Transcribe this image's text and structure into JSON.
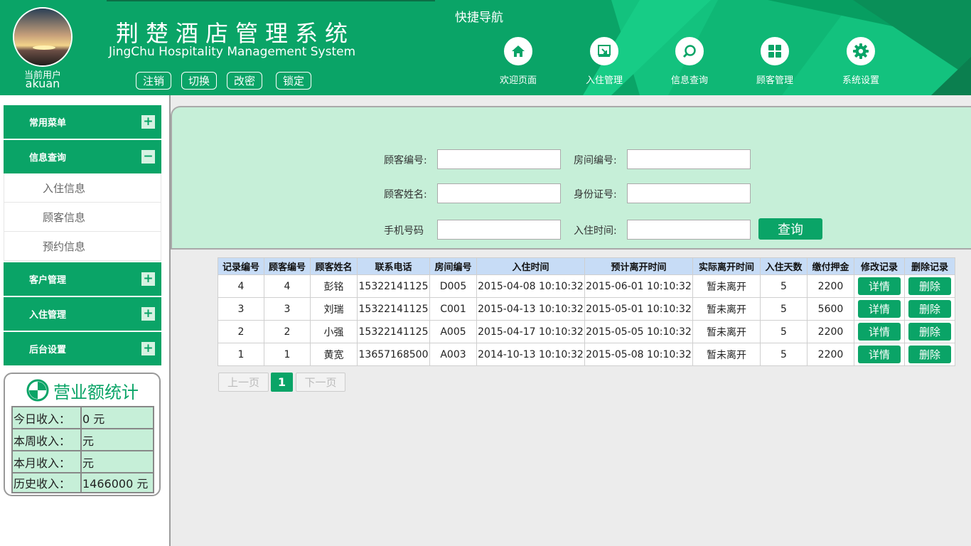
{
  "header": {
    "system_title": "荆楚酒店管理系统",
    "system_subtitle": "JingChu Hospitality Management System",
    "current_user_label": "当前用户",
    "current_user_name": "akuan",
    "user_actions": [
      "注销",
      "切换",
      "改密",
      "锁定"
    ],
    "quick_nav_title": "快捷导航",
    "quick_nav": [
      {
        "label": "欢迎页面",
        "icon": "home-icon"
      },
      {
        "label": "入住管理",
        "icon": "checkin-icon"
      },
      {
        "label": "信息查询",
        "icon": "search-icon"
      },
      {
        "label": "顾客管理",
        "icon": "grid-icon"
      },
      {
        "label": "系统设置",
        "icon": "gear-icon"
      }
    ]
  },
  "sidebar": {
    "menus": [
      {
        "label": "常用菜单",
        "toggle": "+"
      },
      {
        "label": "信息查询",
        "toggle": "−"
      },
      {
        "label": "客户管理",
        "toggle": "+"
      },
      {
        "label": "入住管理",
        "toggle": "+"
      },
      {
        "label": "后台设置",
        "toggle": "+"
      }
    ],
    "submenu": [
      "入住信息",
      "顾客信息",
      "预约信息"
    ]
  },
  "stats": {
    "title": "营业额统计",
    "rows": [
      {
        "label": "今日收入：",
        "value": "0 元"
      },
      {
        "label": "本周收入：",
        "value": "元"
      },
      {
        "label": "本月收入：",
        "value": "元"
      },
      {
        "label": "历史收入：",
        "value": "1466000 元"
      }
    ]
  },
  "search": {
    "customer_id_label": "顾客编号:",
    "room_id_label": "房间编号:",
    "customer_name_label": "顾客姓名:",
    "id_card_label": "身份证号:",
    "phone_label": "手机号码",
    "checkin_time_label": "入住时间:",
    "button": "查询"
  },
  "table": {
    "headers": [
      "记录编号",
      "顾客编号",
      "顾客姓名",
      "联系电话",
      "房间编号",
      "入住时间",
      "预计离开时间",
      "实际离开时间",
      "入住天数",
      "缴付押金",
      "修改记录",
      "删除记录"
    ],
    "rows": [
      [
        "4",
        "4",
        "彭铭",
        "15322141125",
        "D005",
        "2015-04-08 10:10:32",
        "2015-06-01 10:10:32",
        "暂未离开",
        "5",
        "2200"
      ],
      [
        "3",
        "3",
        "刘瑞",
        "15322141125",
        "C001",
        "2015-04-13 10:10:32",
        "2015-05-01 10:10:32",
        "暂未离开",
        "5",
        "5600"
      ],
      [
        "2",
        "2",
        "小强",
        "15322141125",
        "A005",
        "2015-04-17 10:10:32",
        "2015-05-05 10:10:32",
        "暂未离开",
        "5",
        "2200"
      ],
      [
        "1",
        "1",
        "黄宽",
        "13657168500",
        "A003",
        "2014-10-13 10:10:32",
        "2015-05-08 10:10:32",
        "暂未离开",
        "5",
        "2200"
      ]
    ],
    "detail_label": "详情",
    "delete_label": "删除"
  },
  "pager": {
    "prev": "上一页",
    "current": "1",
    "next": "下一页"
  },
  "colors": {
    "brand": "#0aa467",
    "panel": "#c6efd8",
    "table_header": "#c7dcf6"
  }
}
